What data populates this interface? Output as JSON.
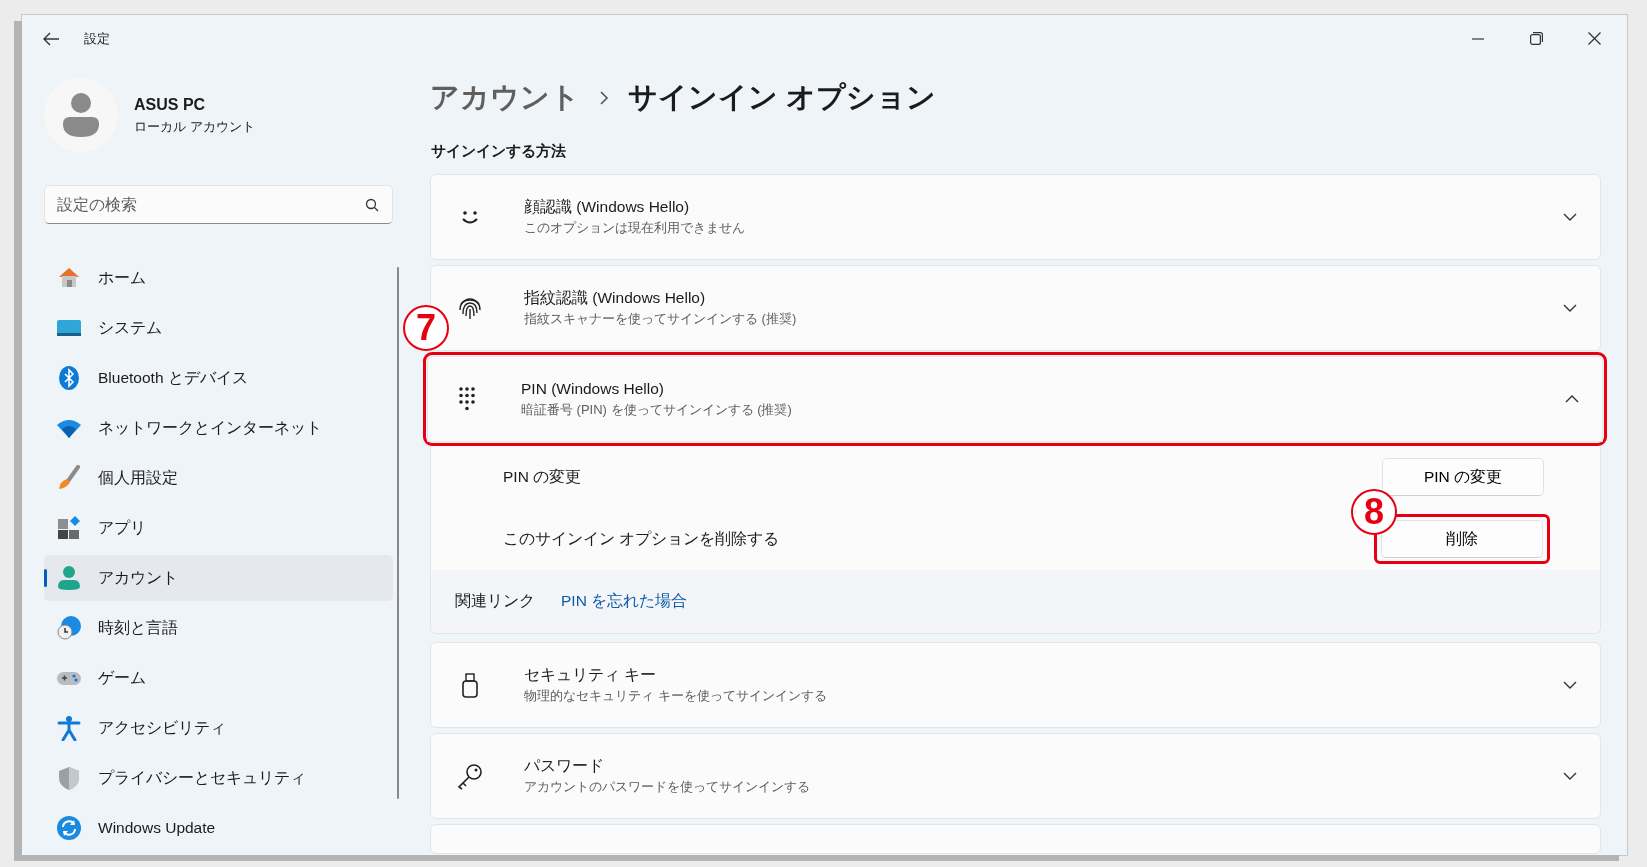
{
  "window": {
    "title": "設定"
  },
  "account": {
    "name": "ASUS PC",
    "type": "ローカル アカウント"
  },
  "search": {
    "placeholder": "設定の検索"
  },
  "nav": [
    {
      "label": "ホーム",
      "selected": false
    },
    {
      "label": "システム",
      "selected": false
    },
    {
      "label": "Bluetooth とデバイス",
      "selected": false
    },
    {
      "label": "ネットワークとインターネット",
      "selected": false
    },
    {
      "label": "個人用設定",
      "selected": false
    },
    {
      "label": "アプリ",
      "selected": false
    },
    {
      "label": "アカウント",
      "selected": true
    },
    {
      "label": "時刻と言語",
      "selected": false
    },
    {
      "label": "ゲーム",
      "selected": false
    },
    {
      "label": "アクセシビリティ",
      "selected": false
    },
    {
      "label": "プライバシーとセキュリティ",
      "selected": false
    },
    {
      "label": "Windows Update",
      "selected": false
    }
  ],
  "breadcrumb": [
    {
      "label": "アカウント"
    },
    {
      "label": "サインイン オプション"
    }
  ],
  "section_title": "サインインする方法",
  "methods": [
    {
      "title": "顔認識 (Windows Hello)",
      "subtitle": "このオプションは現在利用できません",
      "expanded": false,
      "highlighted": false
    },
    {
      "title": "指紋認識 (Windows Hello)",
      "subtitle": "指紋スキャナーを使ってサインインする (推奨)",
      "expanded": false,
      "highlighted": false
    },
    {
      "title": "PIN (Windows Hello)",
      "subtitle": "暗証番号 (PIN) を使ってサインインする (推奨)",
      "expanded": true,
      "highlighted": true,
      "callout": "7",
      "settings": [
        {
          "label": "PIN の変更",
          "button": "PIN の変更",
          "highlighted": false
        },
        {
          "label": "このサインイン オプションを削除する",
          "button": "削除",
          "highlighted": true,
          "callout": "8"
        }
      ],
      "related": {
        "label": "関連リンク",
        "link": "PIN を忘れた場合"
      }
    },
    {
      "title": "セキュリティ キー",
      "subtitle": "物理的なセキュリティ キーを使ってサインインする",
      "expanded": false,
      "highlighted": false
    },
    {
      "title": "パスワード",
      "subtitle": "アカウントのパスワードを使ってサインインする",
      "expanded": false,
      "highlighted": false
    }
  ]
}
